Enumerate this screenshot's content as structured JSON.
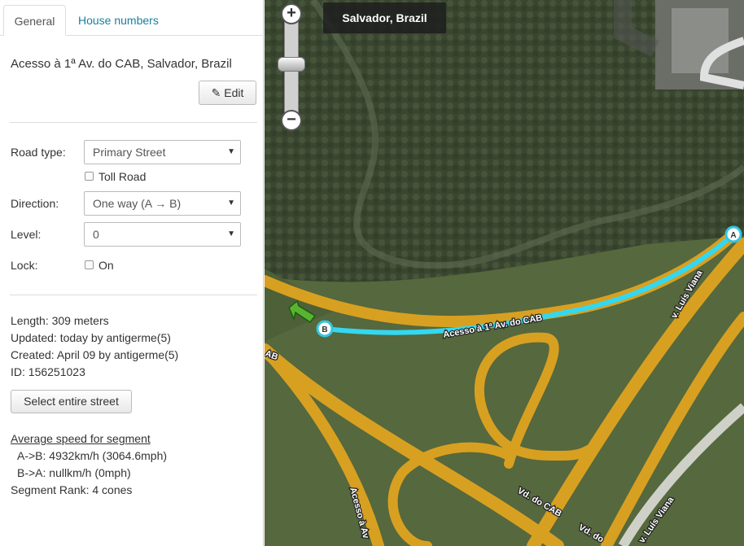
{
  "tabs": [
    {
      "label": "General"
    },
    {
      "label": "House numbers"
    }
  ],
  "segment": {
    "title": "Acesso à 1ª Av. do CAB, Salvador, Brazil",
    "edit_label": "Edit"
  },
  "form": {
    "road_type_label": "Road type:",
    "road_type_value": "Primary Street",
    "toll_road_label": "Toll Road",
    "direction_label": "Direction:",
    "direction_value": "One way (A → B)",
    "level_label": "Level:",
    "level_value": "0",
    "lock_label": "Lock:",
    "lock_on_label": "On"
  },
  "info": {
    "length": "Length: 309 meters",
    "updated": "Updated: today by antigerme(5)",
    "created": "Created: April 09 by antigerme(5)",
    "id": "ID: 156251023",
    "select_street_label": "Select entire street"
  },
  "speed": {
    "heading": "Average speed for segment",
    "a_to_b": "A->B: 4932km/h (3064.6mph)",
    "b_to_a": "B->A: nullkm/h (0mph)",
    "rank": "Segment Rank: 4 cones"
  },
  "map": {
    "location": "Salvador, Brazil",
    "node_a": "A",
    "node_b": "B",
    "road_labels": {
      "segment": "Acesso à 1ª Av. do CAB",
      "luis_viana_top": "v. Luís Viana",
      "cab_left": "AB",
      "vd_cab": "Vd. do CAB",
      "acesso_bottom": "Acesso à Av",
      "luis_viana_bottom": "v. Luís Viana",
      "vd_bottom": "Vd. do"
    },
    "zoom_in": "+",
    "zoom_out": "−",
    "colors": {
      "road": "#d8a021",
      "segment_highlight": "#33d8f0",
      "vegetation": "#3f4b33"
    }
  }
}
